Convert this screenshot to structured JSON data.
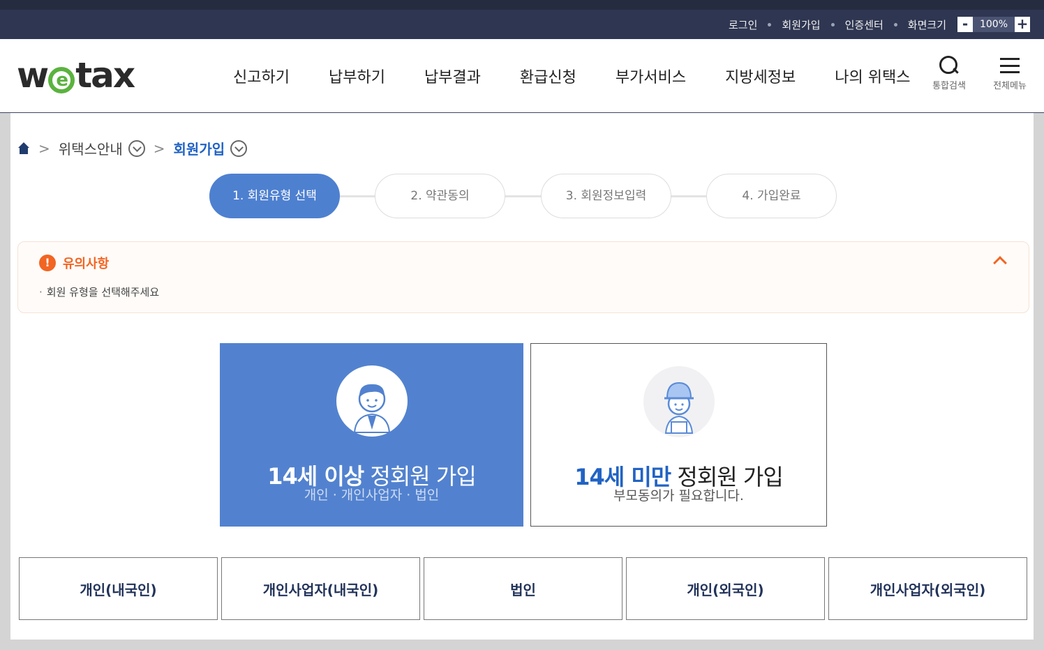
{
  "util": {
    "login": "로그인",
    "join": "회원가입",
    "cert": "인증센터",
    "screen_size": "화면크기",
    "zoom_minus": "-",
    "zoom_value": "100%",
    "zoom_plus": "+"
  },
  "header": {
    "logo_w": "w",
    "logo_e": "e",
    "logo_tax": "tax",
    "nav": [
      "신고하기",
      "납부하기",
      "납부결과",
      "환급신청",
      "부가서비스",
      "지방세정보",
      "나의 위택스"
    ],
    "search_label": "통합검색",
    "menu_label": "전체메뉴"
  },
  "breadcrumb": {
    "level1": "위택스안내",
    "level2": "회원가입",
    "separator": ">"
  },
  "steps": [
    "1. 회원유형 선택",
    "2. 약관동의",
    "3. 회원정보입력",
    "4. 가입완료"
  ],
  "notice": {
    "icon": "!",
    "title": "유의사항",
    "text": "회원 유형을 선택해주세요"
  },
  "cards": {
    "adult": {
      "title_em": "14세 이상",
      "title_rest": " 정회원 가입",
      "sub": "개인 · 개인사업자 · 법인"
    },
    "minor": {
      "title_em": "14세 미만",
      "title_rest": " 정회원 가입",
      "sub": "부모동의가 필요합니다."
    }
  },
  "member_types": [
    "개인(내국인)",
    "개인사업자(내국인)",
    "법인",
    "개인(외국인)",
    "개인사업자(외국인)"
  ],
  "colors": {
    "top_bar": "#2e3651",
    "accent_blue": "#4e80d0",
    "notice_orange": "#f26522",
    "logo_green": "#5bb33e"
  }
}
